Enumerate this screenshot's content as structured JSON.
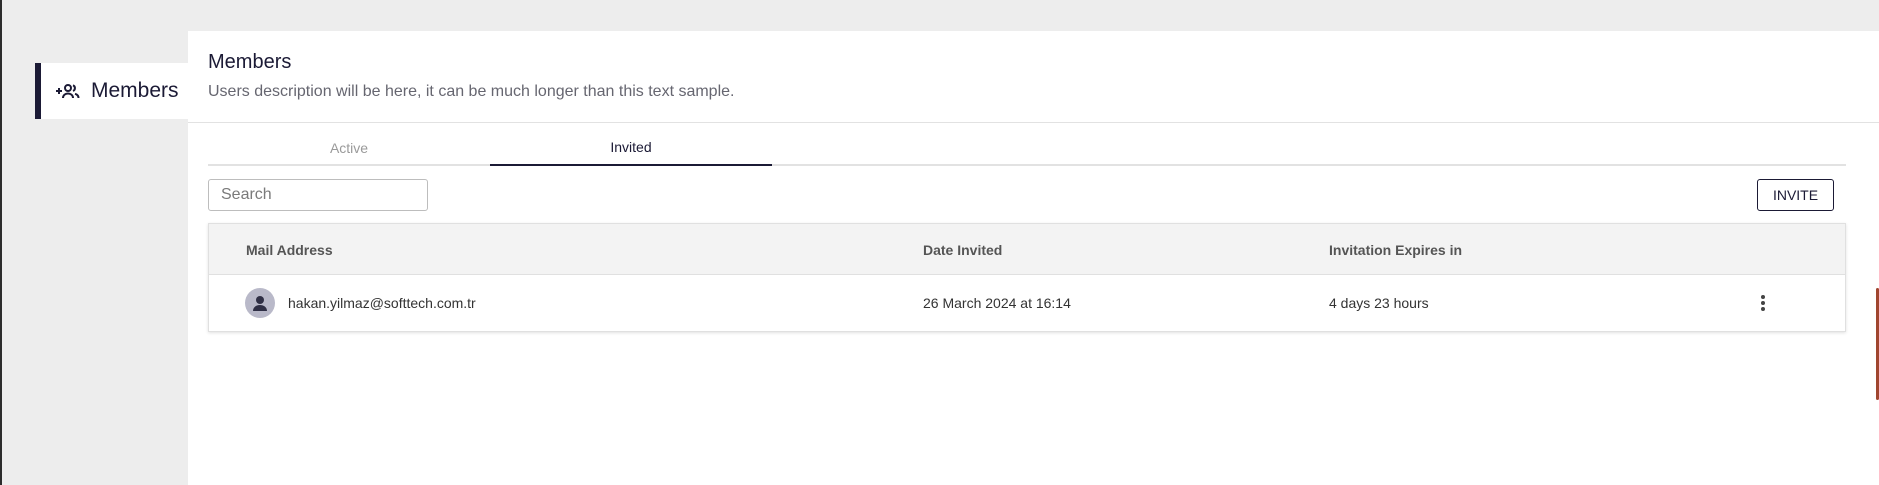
{
  "sidebar": {
    "items": [
      {
        "label": "Members",
        "icon": "group-add-icon"
      }
    ]
  },
  "header": {
    "title": "Members",
    "description": "Users description will be here, it can be much longer than this text sample."
  },
  "tabs": [
    {
      "label": "Active",
      "selected": false
    },
    {
      "label": "Invited",
      "selected": true
    }
  ],
  "toolbar": {
    "search_placeholder": "Search",
    "search_value": "",
    "invite_label": "INVITE"
  },
  "table": {
    "columns": [
      "Mail Address",
      "Date Invited",
      "Invitation Expires in"
    ],
    "rows": [
      {
        "avatar_icon": "person-icon",
        "mail": "hakan.yilmaz@softtech.com.tr",
        "date_invited": "26 March 2024 at 16:14",
        "expires_in": "4 days 23 hours",
        "action_icon": "more-vert-icon"
      }
    ]
  },
  "colors": {
    "accent": "#1b1a35",
    "background": "#ededed",
    "panel": "#ffffff",
    "table_header": "#f3f3f3"
  }
}
